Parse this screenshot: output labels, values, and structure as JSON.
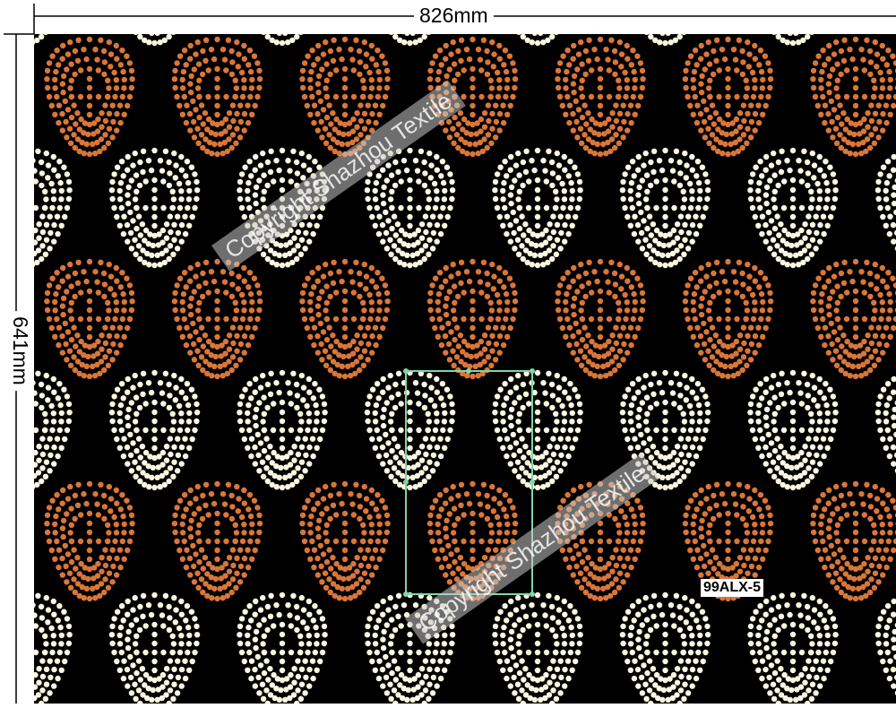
{
  "dimensions": {
    "width_label": "826mm",
    "height_label": "641mm"
  },
  "pattern": {
    "code": "99ALX-5",
    "background_color": "#000000",
    "motif_colors": {
      "orange": "#d9763a",
      "cream": "#fbf6df"
    },
    "repeat_frame_color": "#7fd6a6"
  },
  "watermark": {
    "text": "Copyright Shazhou Textile"
  }
}
